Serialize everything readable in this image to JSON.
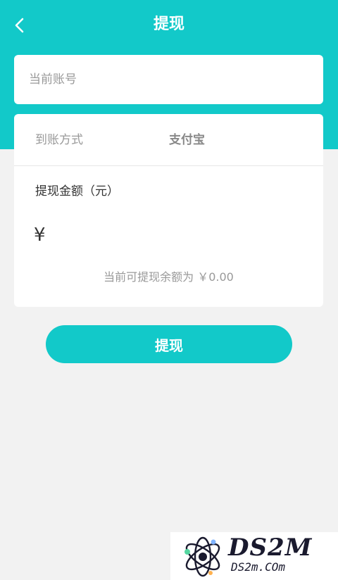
{
  "header": {
    "title": "提现",
    "back_icon": "chevron-left-icon"
  },
  "account": {
    "placeholder": "当前账号",
    "value": ""
  },
  "withdraw_method": {
    "label": "到账方式",
    "value": "支付宝"
  },
  "amount": {
    "label": "提现金额（元）",
    "currency_symbol": "¥",
    "value": ""
  },
  "balance_text": "当前可提现余额为 ￥0.00",
  "submit_label": "提现",
  "watermark": {
    "brand": "DS2M",
    "domain": "DS2m.COm"
  },
  "colors": {
    "accent": "#12c9c9",
    "background": "#f2f2f2",
    "card": "#ffffff"
  }
}
